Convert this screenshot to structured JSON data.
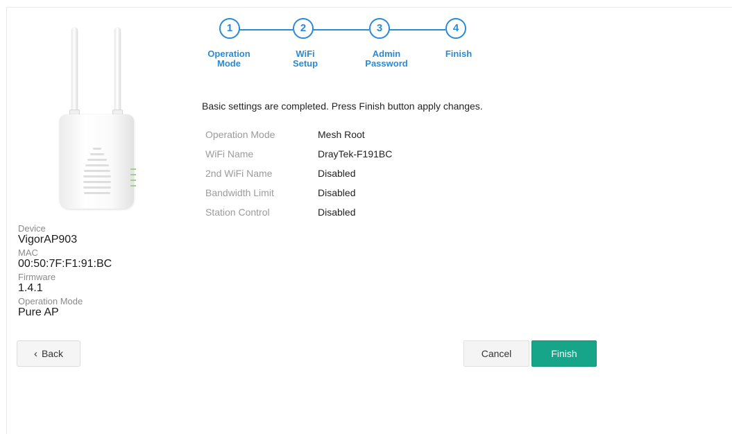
{
  "device_image": {
    "icon": "access-point-device-image"
  },
  "device_info": {
    "device_label": "Device",
    "device_value": "VigorAP903",
    "mac_label": "MAC",
    "mac_value": "00:50:7F:F1:91:BC",
    "firmware_label": "Firmware",
    "firmware_value": "1.4.1",
    "mode_label": "Operation Mode",
    "mode_value": "Pure AP"
  },
  "stepper": {
    "accent": "#2a8ad6",
    "steps": [
      {
        "number": "1",
        "label": "Operation\nMode"
      },
      {
        "number": "2",
        "label": "WiFi\nSetup"
      },
      {
        "number": "3",
        "label": "Admin\nPassword"
      },
      {
        "number": "4",
        "label": "Finish"
      }
    ]
  },
  "message": "Basic settings are completed. Press Finish button apply changes.",
  "summary": [
    {
      "key": "Operation Mode",
      "value": "Mesh Root"
    },
    {
      "key": "WiFi Name",
      "value": "DrayTek-F191BC"
    },
    {
      "key": "2nd WiFi Name",
      "value": "Disabled"
    },
    {
      "key": "Bandwidth Limit",
      "value": "Disabled"
    },
    {
      "key": "Station Control",
      "value": "Disabled"
    }
  ],
  "buttons": {
    "back_icon": "chevron-left-icon",
    "back_label": "Back",
    "cancel_label": "Cancel",
    "finish_label": "Finish",
    "finish_color": "#17a58a"
  }
}
